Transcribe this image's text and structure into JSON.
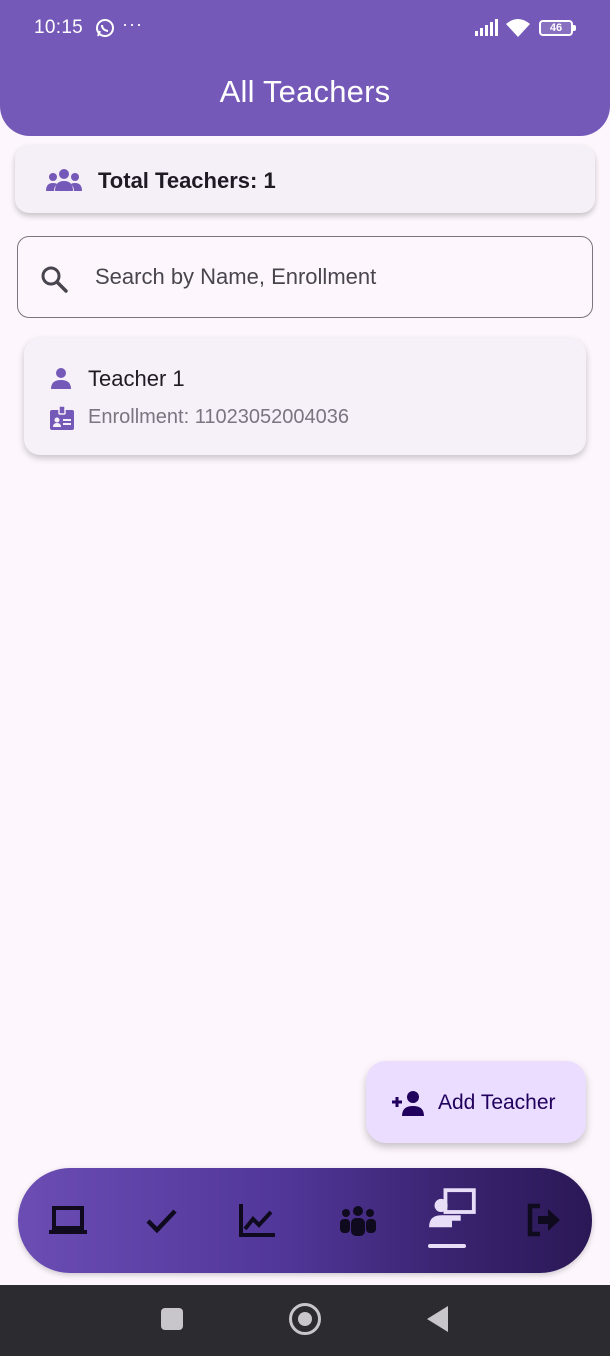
{
  "status_bar": {
    "time": "10:15",
    "dots": "···",
    "battery": "46"
  },
  "header": {
    "title": "All Teachers"
  },
  "summary": {
    "total_label": "Total Teachers: 1"
  },
  "search": {
    "placeholder": "Search by Name, Enrollment",
    "value": ""
  },
  "teachers": [
    {
      "name": "Teacher 1",
      "enrollment": "Enrollment: 11023052004036"
    }
  ],
  "fab": {
    "label": "Add Teacher"
  },
  "bottom_nav": {
    "items": [
      {
        "icon": "laptop-icon"
      },
      {
        "icon": "check-icon"
      },
      {
        "icon": "trending-up-icon"
      },
      {
        "icon": "groups-icon"
      },
      {
        "icon": "teacher-screen-icon",
        "selected": true
      },
      {
        "icon": "logout-icon"
      }
    ]
  },
  "colors": {
    "primary": "#7559b8",
    "background": "#fdf7fd",
    "fab": "#eaddff",
    "nav_start": "#6b4db3",
    "nav_end": "#2a1856"
  }
}
